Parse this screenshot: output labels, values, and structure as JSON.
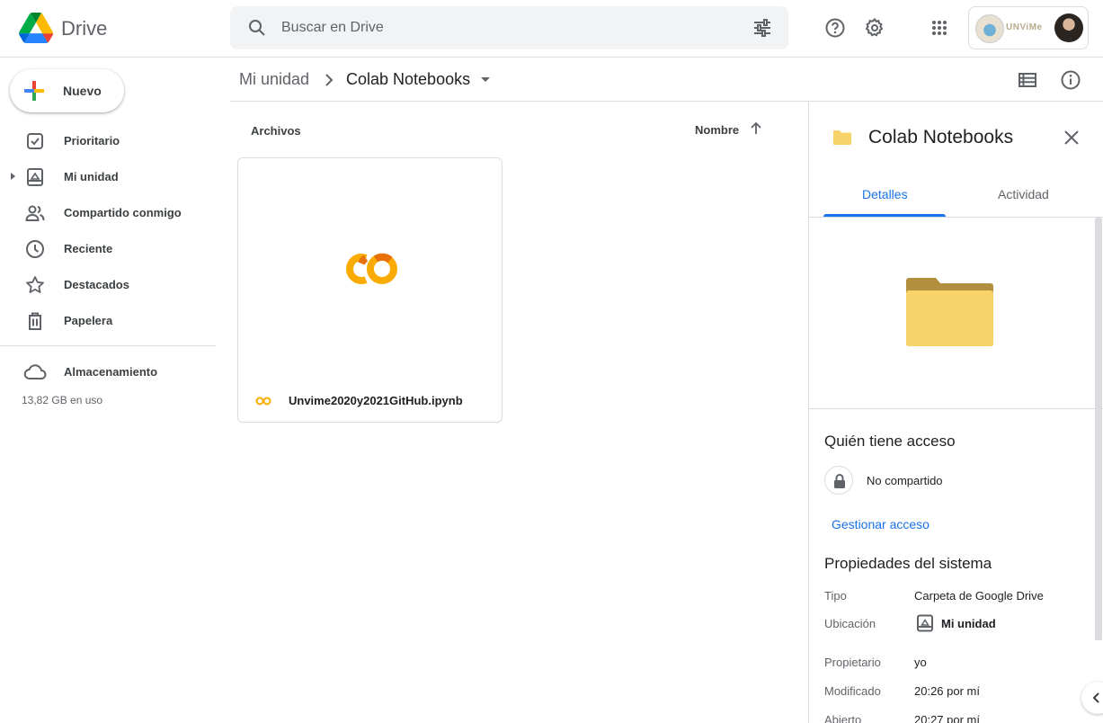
{
  "header": {
    "app_name": "Drive",
    "search_placeholder": "Buscar en Drive",
    "org_name": "UNViMe"
  },
  "sidebar": {
    "new_label": "Nuevo",
    "items": [
      {
        "label": "Prioritario",
        "icon": "priority-icon"
      },
      {
        "label": "Mi unidad",
        "icon": "my-drive-icon"
      },
      {
        "label": "Compartido conmigo",
        "icon": "shared-icon"
      },
      {
        "label": "Reciente",
        "icon": "clock-icon"
      },
      {
        "label": "Destacados",
        "icon": "star-icon"
      },
      {
        "label": "Papelera",
        "icon": "trash-icon"
      }
    ],
    "storage_label": "Almacenamiento",
    "storage_usage": "13,82 GB en uso"
  },
  "breadcrumb": {
    "root": "Mi unidad",
    "current": "Colab Notebooks"
  },
  "files": {
    "section_label": "Archivos",
    "sort_label": "Nombre",
    "items": [
      {
        "name": "Unvime2020y2021GitHub.ipynb",
        "thumb_text": "CO"
      }
    ]
  },
  "details": {
    "title": "Colab Notebooks",
    "tabs": [
      "Detalles",
      "Actividad"
    ],
    "access_heading": "Quién tiene acceso",
    "share_status": "No compartido",
    "manage_access": "Gestionar acceso",
    "props_heading": "Propiedades del sistema",
    "props": [
      {
        "key": "Tipo",
        "value": "Carpeta de Google Drive"
      },
      {
        "key": "Ubicación",
        "value": "Mi unidad"
      },
      {
        "key": "Propietario",
        "value": "yo"
      },
      {
        "key": "Modificado",
        "value": "20:26 por mí"
      },
      {
        "key": "Abierto",
        "value": "20:27 por mí"
      }
    ]
  },
  "colors": {
    "accent": "#1a73e8",
    "folder": "#f8d36a",
    "colab": "#f9ab00"
  }
}
